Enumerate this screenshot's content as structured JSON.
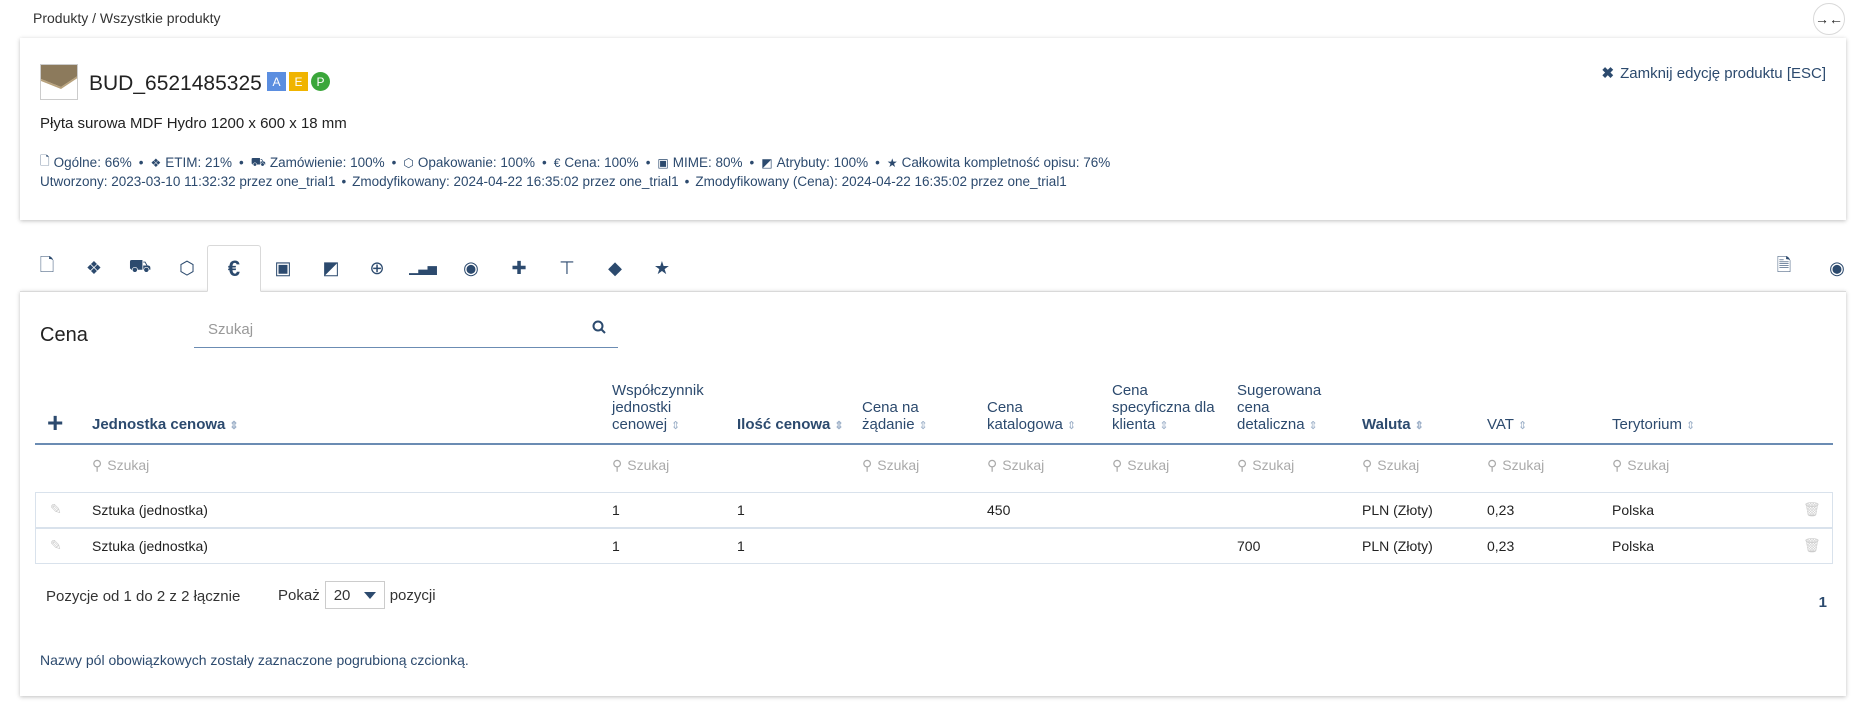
{
  "breadcrumb": "Produkty / Wszystkie produkty",
  "product": {
    "sku": "BUD_6521485325",
    "badges": [
      "A",
      "E",
      "P"
    ],
    "name": "Płyta surowa MDF Hydro 1200 x 600 x 18 mm",
    "close_label": "Zamknij edycję produktu [ESC]"
  },
  "stats": [
    {
      "icon": "file-icon",
      "glyph": "🗋",
      "label": "Ogólne: 66%"
    },
    {
      "icon": "etim-icon",
      "glyph": "❖",
      "label": "ETIM: 21%"
    },
    {
      "icon": "truck-icon",
      "glyph": "⛟",
      "label": "Zamówienie: 100%"
    },
    {
      "icon": "box-icon",
      "glyph": "⬡",
      "label": "Opakowanie: 100%"
    },
    {
      "icon": "euro-icon",
      "glyph": "€",
      "label": "Cena: 100%"
    },
    {
      "icon": "image-icon",
      "glyph": "▣",
      "label": "MIME: 80%"
    },
    {
      "icon": "note-icon",
      "glyph": "◩",
      "label": "Atrybuty: 100%"
    },
    {
      "icon": "star-icon",
      "glyph": "★",
      "label": "Całkowita kompletność opisu: 76%"
    }
  ],
  "meta": {
    "created": "Utworzony: 2023-03-10 11:32:32 przez one_trial1",
    "modified": "Zmodyfikowany: 2024-04-22 16:35:02 przez one_trial1",
    "modified_price": "Zmodyfikowany (Cena): 2024-04-22 16:35:02 przez one_trial1"
  },
  "tabs": [
    {
      "icon": "file-icon",
      "glyph": "🗋"
    },
    {
      "icon": "etim-icon",
      "glyph": "❖"
    },
    {
      "icon": "truck-icon",
      "glyph": "⛟"
    },
    {
      "icon": "box-icon",
      "glyph": "⬡"
    },
    {
      "icon": "euro-icon",
      "glyph": "€",
      "active": true
    },
    {
      "icon": "image-icon",
      "glyph": "▣"
    },
    {
      "icon": "note-icon",
      "glyph": "◩"
    },
    {
      "icon": "plus-circle-icon",
      "glyph": "⊕"
    },
    {
      "icon": "signal-icon",
      "glyph": "▁▃▅"
    },
    {
      "icon": "globe-icon",
      "glyph": "◉"
    },
    {
      "icon": "puzzle-icon",
      "glyph": "✚"
    },
    {
      "icon": "sitemap-icon",
      "glyph": "⊤"
    },
    {
      "icon": "tag-icon",
      "glyph": "◆"
    },
    {
      "icon": "star-icon",
      "glyph": "★"
    }
  ],
  "right_tabs": [
    {
      "icon": "document-icon",
      "glyph": "🗎"
    },
    {
      "icon": "eye-icon",
      "glyph": "◉"
    }
  ],
  "section": {
    "title": "Cena",
    "search_placeholder": "Szukaj"
  },
  "columns": [
    {
      "label": "Jednostka cenowa",
      "bold": true
    },
    {
      "label": "Współczynnik jednostki cenowej",
      "bold": false
    },
    {
      "label": "Ilość cenowa",
      "bold": true
    },
    {
      "label": "Cena na żądanie",
      "bold": false
    },
    {
      "label": "Cena katalogowa",
      "bold": false
    },
    {
      "label": "Cena specyficzna dla klienta",
      "bold": false
    },
    {
      "label": "Sugerowana cena detaliczna",
      "bold": false
    },
    {
      "label": "Waluta",
      "bold": true
    },
    {
      "label": "VAT",
      "bold": false
    },
    {
      "label": "Terytorium",
      "bold": false
    }
  ],
  "filter_placeholder": "Szukaj",
  "rows": [
    [
      "Sztuka (jednostka)",
      "1",
      "1",
      "",
      "450",
      "",
      "",
      "PLN (Złoty)",
      "0,23",
      "Polska"
    ],
    [
      "Sztuka (jednostka)",
      "1",
      "1",
      "",
      "",
      "",
      "700",
      "PLN (Złoty)",
      "0,23",
      "Polska"
    ]
  ],
  "footer": {
    "info": "Pozycje od 1 do 2 z 2 łącznie",
    "show_label": "Pokaż",
    "page_size": "20",
    "items_label": "pozycji",
    "page": "1",
    "note": "Nazwy pól obowiązkowych zostały zaznaczone pogrubioną czcionką."
  }
}
